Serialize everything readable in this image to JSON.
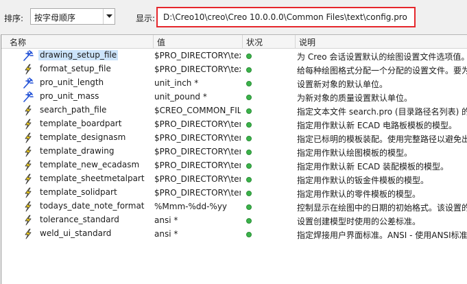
{
  "toolbar": {
    "sort_label": "排序:",
    "sort_value": "按字母顺序",
    "show_label": "显示:",
    "path": "D:\\Creo10\\creo\\Creo 10.0.0.0\\Common Files\\text\\config.pro"
  },
  "columns": [
    "名称",
    "值",
    "状况",
    "说明"
  ],
  "rows": [
    {
      "name": "drawing_setup_file",
      "value": "$PRO_DIRECTORY\\text",
      "desc": "为 Creo 会话设置默认的绘图设置文件选项值。",
      "icon": "star-burst-icon"
    },
    {
      "name": "format_setup_file",
      "value": "$PRO_DIRECTORY\\text",
      "desc": "给每种绘图格式分配一个分配的设置文件。要为",
      "icon": "lightning-icon"
    },
    {
      "name": "pro_unit_length",
      "value": "unit_inch *",
      "desc": "设置新对象的默认单位。",
      "icon": "star-burst-icon"
    },
    {
      "name": "pro_unit_mass",
      "value": "unit_pound *",
      "desc": "为新对象的质量设置默认单位。",
      "icon": "star-burst-icon"
    },
    {
      "name": "search_path_file",
      "value": "$CREO_COMMON_FILES",
      "desc": "指定文本文件 search.pro (目录路径名列表) 的",
      "icon": "lightning-icon"
    },
    {
      "name": "template_boardpart",
      "value": "$PRO_DIRECTORY\\templates",
      "desc": "指定用作默认新 ECAD 电路板模板的模型。",
      "icon": "lightning-icon"
    },
    {
      "name": "template_designasm",
      "value": "$PRO_DIRECTORY\\templates",
      "desc": "指定已标明的模板装配。使用完整路径以避免出",
      "icon": "lightning-icon"
    },
    {
      "name": "template_drawing",
      "value": "$PRO_DIRECTORY\\templates",
      "desc": "指定用作默认绘图模板的模型。",
      "icon": "lightning-icon"
    },
    {
      "name": "template_new_ecadasm",
      "value": "$PRO_DIRECTORY\\templates",
      "desc": "指定用作默认新 ECAD 装配模板的模型。",
      "icon": "lightning-icon"
    },
    {
      "name": "template_sheetmetalpart",
      "value": "$PRO_DIRECTORY\\templates",
      "desc": "指定用作默认的钣金件模板的模型。",
      "icon": "lightning-icon"
    },
    {
      "name": "template_solidpart",
      "value": "$PRO_DIRECTORY\\templates",
      "desc": "指定用作默认的零件模板的模型。",
      "icon": "lightning-icon"
    },
    {
      "name": "todays_date_note_format",
      "value": "%Mmm-%dd-%yy",
      "desc": "控制显示在绘图中的日期的初始格式。该设置的",
      "icon": "lightning-icon"
    },
    {
      "name": "tolerance_standard",
      "value": "ansi *",
      "desc": "设置创建模型时使用的公差标准。",
      "icon": "lightning-icon"
    },
    {
      "name": "weld_ui_standard",
      "value": "ansi *",
      "desc": "指定焊接用户界面标准。ANSI - 使用ANSI标准",
      "icon": "lightning-icon"
    }
  ]
}
